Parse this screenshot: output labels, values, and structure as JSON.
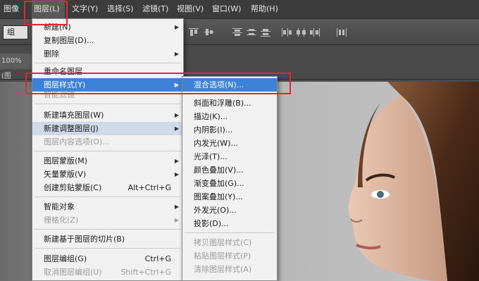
{
  "menubar": {
    "items": [
      {
        "label": "图像"
      },
      {
        "label": "图层(L)"
      },
      {
        "label": "文字(Y)"
      },
      {
        "label": "选择(S)"
      },
      {
        "label": "滤镜(T)"
      },
      {
        "label": "视图(V)"
      },
      {
        "label": "窗口(W)"
      },
      {
        "label": "帮助(H)"
      }
    ]
  },
  "options_bar": {
    "auto_select_value": "组"
  },
  "doc_tab": {
    "label": "100% (图"
  },
  "layer_menu": {
    "items": [
      {
        "label": "新建(N)",
        "shortcut": "",
        "arrow": true,
        "disabled": false
      },
      {
        "label": "复制图层(D)...",
        "shortcut": "",
        "arrow": false,
        "disabled": false
      },
      {
        "label": "删除",
        "shortcut": "",
        "arrow": true,
        "disabled": false
      },
      {
        "label": "重命名图层...",
        "shortcut": "",
        "arrow": false,
        "disabled": false
      },
      {
        "label": "图层样式(Y)",
        "shortcut": "",
        "arrow": true,
        "disabled": false
      },
      {
        "label": "智能滤镜",
        "shortcut": "",
        "arrow": false,
        "disabled": true
      },
      {
        "label": "新建填充图层(W)",
        "shortcut": "",
        "arrow": true,
        "disabled": false
      },
      {
        "label": "新建调整图层(J)",
        "shortcut": "",
        "arrow": true,
        "disabled": false
      },
      {
        "label": "图层内容选项(O)...",
        "shortcut": "",
        "arrow": false,
        "disabled": true
      },
      {
        "label": "图层蒙版(M)",
        "shortcut": "",
        "arrow": true,
        "disabled": false
      },
      {
        "label": "矢量蒙版(V)",
        "shortcut": "",
        "arrow": true,
        "disabled": false
      },
      {
        "label": "创建剪贴蒙版(C)",
        "shortcut": "Alt+Ctrl+G",
        "arrow": false,
        "disabled": false
      },
      {
        "label": "智能对象",
        "shortcut": "",
        "arrow": true,
        "disabled": false
      },
      {
        "label": "栅格化(Z)",
        "shortcut": "",
        "arrow": true,
        "disabled": true
      },
      {
        "label": "新建基于图层的切片(B)",
        "shortcut": "",
        "arrow": false,
        "disabled": false
      },
      {
        "label": "图层编组(G)",
        "shortcut": "Ctrl+G",
        "arrow": false,
        "disabled": false
      },
      {
        "label": "取消图层编组(U)",
        "shortcut": "Shift+Ctrl+G",
        "arrow": false,
        "disabled": true
      }
    ]
  },
  "style_menu": {
    "items": [
      {
        "label": "混合选项(N)...",
        "disabled": false
      },
      {
        "label": "斜面和浮雕(B)...",
        "disabled": false
      },
      {
        "label": "描边(K)...",
        "disabled": false
      },
      {
        "label": "内阴影(I)...",
        "disabled": false
      },
      {
        "label": "内发光(W)...",
        "disabled": false
      },
      {
        "label": "光泽(T)...",
        "disabled": false
      },
      {
        "label": "颜色叠加(V)...",
        "disabled": false
      },
      {
        "label": "渐变叠加(G)...",
        "disabled": false
      },
      {
        "label": "图案叠加(Y)...",
        "disabled": false
      },
      {
        "label": "外发光(O)...",
        "disabled": false
      },
      {
        "label": "投影(D)...",
        "disabled": false
      },
      {
        "label": "拷贝图层样式(C)",
        "disabled": true
      },
      {
        "label": "粘贴图层样式(P)",
        "disabled": true
      },
      {
        "label": "清除图层样式(A)",
        "disabled": true
      }
    ]
  },
  "colors": {
    "highlight": "#3c82d8",
    "annotation_red": "#e0292f",
    "menubar_bg": "#3c3c3c"
  }
}
